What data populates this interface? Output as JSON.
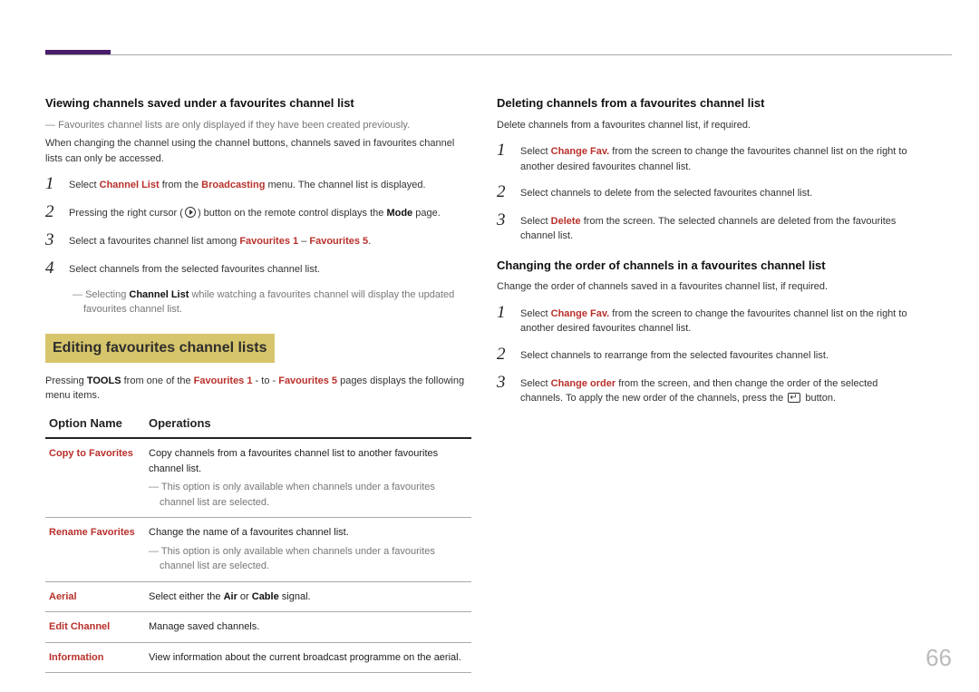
{
  "page_number": "66",
  "left": {
    "h_viewing": "Viewing channels saved under a favourites channel list",
    "viewing_note": "Favourites channel lists are only displayed if they have been created previously.",
    "viewing_intro": "When changing the channel using the channel buttons, channels saved in favourites channel lists can only be accessed.",
    "vsteps": [
      {
        "pre": "Select ",
        "r1": "Channel List",
        "mid": " from the ",
        "r2": "Broadcasting",
        "post": " menu. The channel list is displayed."
      },
      {
        "pre": "Pressing the right cursor (",
        "post": ") button on the remote control displays the ",
        "r1": "Mode",
        "tail": " page.",
        "play": true
      },
      {
        "pre": "Select a favourites channel list among ",
        "r1": "Favourites 1",
        "mid": " – ",
        "r2": "Favourites 5",
        "post": "."
      },
      {
        "pre": "Select channels from the selected favourites channel list."
      }
    ],
    "vstep_after_note_pre": "Selecting ",
    "vstep_after_note_r": "Channel List",
    "vstep_after_note_post": " while watching a favourites channel will display the updated favourites channel list.",
    "h2_editing": "Editing favourites channel lists",
    "editing_intro_pre": "Pressing ",
    "editing_intro_s1": "TOOLS",
    "editing_intro_mid": " from one of the ",
    "editing_intro_r1": "Favourites 1",
    "editing_intro_mid2": " - to - ",
    "editing_intro_r2": "Favourites 5",
    "editing_intro_post": " pages displays the following menu items.",
    "th1": "Option Name",
    "th2": "Operations",
    "rows": [
      {
        "name": "Copy to Favorites",
        "op": "Copy channels from a favourites channel list to another favourites channel list.",
        "note": "This option is only available when channels under a favourites channel list are selected."
      },
      {
        "name": "Rename Favorites",
        "op": "Change the name of a favourites channel list.",
        "note": "This option is only available when channels under a favourites channel list are selected."
      },
      {
        "name": "Aerial",
        "op_pre": "Select either the ",
        "op_s1": "Air",
        "op_mid": " or ",
        "op_s2": "Cable",
        "op_post": " signal."
      },
      {
        "name": "Edit Channel",
        "op": "Manage saved channels."
      },
      {
        "name": "Information",
        "op": "View information about the current broadcast programme on the aerial."
      }
    ]
  },
  "right": {
    "h_deleting": "Deleting channels from a favourites channel list",
    "del_intro": "Delete channels from a favourites channel list, if required.",
    "dsteps": [
      {
        "pre": "Select ",
        "r1": "Change Fav.",
        "post": " from the screen to change the favourites channel list on the right to another desired favourites channel list."
      },
      {
        "pre": "Select channels to delete from the selected favourites channel list."
      },
      {
        "pre": "Select ",
        "r1": "Delete",
        "post": " from the screen. The selected channels are deleted from the favourites channel list."
      }
    ],
    "h_changing": "Changing the order of channels in a favourites channel list",
    "chg_intro": "Change the order of channels saved in a favourites channel list, if required.",
    "csteps": [
      {
        "pre": "Select ",
        "r1": "Change Fav.",
        "post": " from the screen to change the favourites channel list on the right to another desired favourites channel list."
      },
      {
        "pre": "Select channels to rearrange from the selected favourites channel list."
      },
      {
        "pre": "Select ",
        "r1": "Change order",
        "post": " from the screen, and then change the order of the selected channels. To apply the new order of the channels, press the ",
        "enter": true,
        "tail": " button."
      }
    ]
  }
}
